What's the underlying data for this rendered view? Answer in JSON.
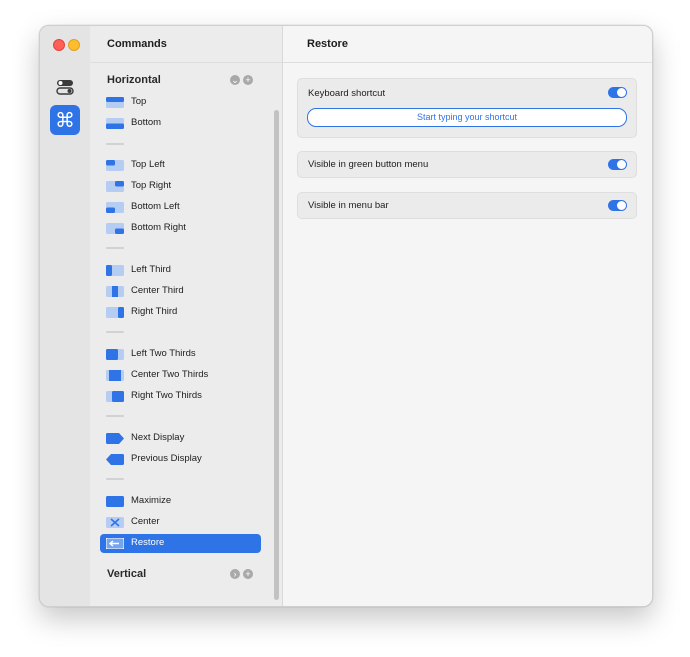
{
  "sidebar": {
    "title": "Commands",
    "sections": {
      "horizontal": {
        "title": "Horizontal"
      },
      "vertical": {
        "title": "Vertical"
      }
    },
    "items": [
      {
        "label": "Top",
        "icon": "top-half-icon"
      },
      {
        "label": "Bottom",
        "icon": "bottom-half-icon"
      },
      {
        "label": "Top Left",
        "icon": "top-left-icon"
      },
      {
        "label": "Top Right",
        "icon": "top-right-icon"
      },
      {
        "label": "Bottom Left",
        "icon": "bottom-left-icon"
      },
      {
        "label": "Bottom Right",
        "icon": "bottom-right-icon"
      },
      {
        "label": "Left Third",
        "icon": "left-third-icon"
      },
      {
        "label": "Center Third",
        "icon": "center-third-icon"
      },
      {
        "label": "Right Third",
        "icon": "right-third-icon"
      },
      {
        "label": "Left Two Thirds",
        "icon": "left-two-thirds-icon"
      },
      {
        "label": "Center Two Thirds",
        "icon": "center-two-thirds-icon"
      },
      {
        "label": "Right Two Thirds",
        "icon": "right-two-thirds-icon"
      },
      {
        "label": "Next Display",
        "icon": "next-display-icon"
      },
      {
        "label": "Previous Display",
        "icon": "previous-display-icon"
      },
      {
        "label": "Maximize",
        "icon": "maximize-icon"
      },
      {
        "label": "Center",
        "icon": "center-icon"
      },
      {
        "label": "Restore",
        "icon": "restore-icon",
        "selected": true
      }
    ]
  },
  "main": {
    "title": "Restore",
    "keyboard_shortcut": {
      "label": "Keyboard shortcut",
      "enabled": true,
      "button": "Start typing your shortcut"
    },
    "green_button_menu": {
      "label": "Visible in green button menu",
      "enabled": true
    },
    "menu_bar": {
      "label": "Visible in menu bar",
      "enabled": true
    }
  },
  "colors": {
    "accent": "#2f74e6",
    "icon_light": "#b6cdf3"
  }
}
